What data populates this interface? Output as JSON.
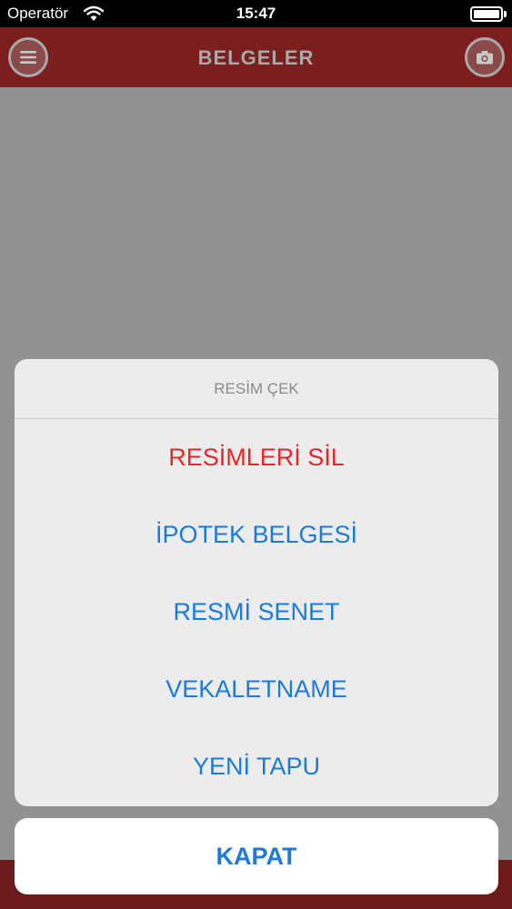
{
  "status_bar": {
    "carrier": "Operatör",
    "time": "15:47",
    "wifi_icon": "wifi-icon",
    "battery_icon": "battery-icon"
  },
  "nav_bar": {
    "title": "BELGELER",
    "left_icon": "menu-icon",
    "right_icon": "camera-icon",
    "color": "#7c1d1e"
  },
  "action_sheet": {
    "title": "RESİM ÇEK",
    "options": [
      {
        "label": "RESİMLERİ SİL",
        "style": "destructive"
      },
      {
        "label": "İPOTEK BELGESİ",
        "style": "default"
      },
      {
        "label": "RESMİ SENET",
        "style": "default"
      },
      {
        "label": "VEKALETNAME",
        "style": "default"
      },
      {
        "label": "YENİ TAPU",
        "style": "default"
      }
    ],
    "cancel_label": "KAPAT",
    "accent_color": "#1d7ad8",
    "destructive_color": "#e8262a"
  }
}
